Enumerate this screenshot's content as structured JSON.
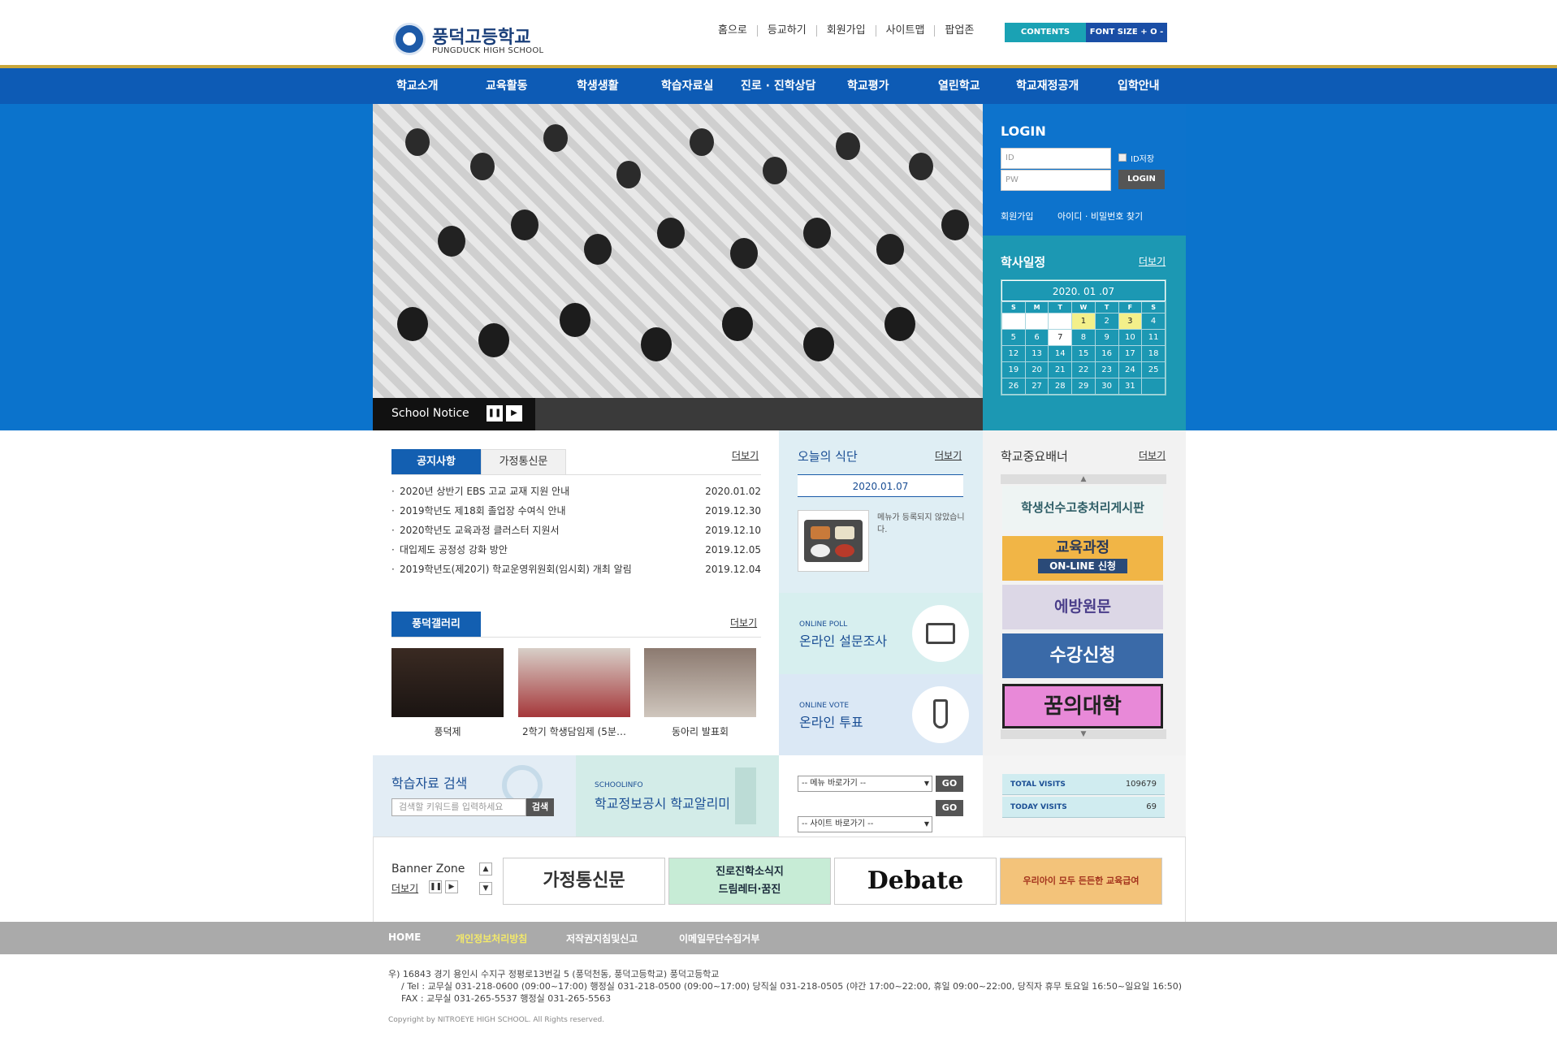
{
  "header": {
    "school_name": "풍덕고등학교",
    "school_name_en": "PUNGDUCK HIGH SCHOOL",
    "top_links": [
      "홈으로",
      "등교하기",
      "회원가입",
      "사이트맵",
      "팝업존"
    ],
    "contents_btn": "CONTENTS",
    "fontsize_btn": "FONT SIZE + O -"
  },
  "gnb": [
    "학교소개",
    "교육활동",
    "학생생활",
    "학습자료실",
    "진로 · 진학상담",
    "학교평가",
    "열린학교",
    "학교재정공개",
    "입학안내"
  ],
  "hero": {
    "notice_label": "School Notice",
    "pause_icon": "pause-icon",
    "next_icon": "next-icon"
  },
  "login": {
    "title": "LOGIN",
    "id_placeholder": "ID",
    "pw_placeholder": "PW",
    "id_save": "ID저장",
    "login_btn": "LOGIN",
    "join": "회원가입",
    "find": "아이디 · 비밀번호 찾기"
  },
  "calendar": {
    "title": "학사일정",
    "more": "더보기",
    "month": "2020. 01 .07",
    "dow": [
      "S",
      "M",
      "T",
      "W",
      "T",
      "F",
      "S"
    ],
    "weeks": [
      [
        "",
        "",
        "",
        "1",
        "2",
        "3",
        "4"
      ],
      [
        "5",
        "6",
        "7",
        "8",
        "9",
        "10",
        "11"
      ],
      [
        "12",
        "13",
        "14",
        "15",
        "16",
        "17",
        "18"
      ],
      [
        "19",
        "20",
        "21",
        "22",
        "23",
        "24",
        "25"
      ],
      [
        "26",
        "27",
        "28",
        "29",
        "30",
        "31",
        ""
      ]
    ],
    "highlight_days": [
      "1",
      "3"
    ],
    "today": "7",
    "highlight_color": "#f3f08a"
  },
  "notice": {
    "tab_active": "공지사항",
    "tab_inactive": "가정통신문",
    "more": "더보기",
    "items": [
      {
        "title": "2020년 상반기 EBS 고교 교재 지원 안내",
        "date": "2020.01.02"
      },
      {
        "title": "2019학년도 제18회 졸업장 수여식 안내",
        "date": "2019.12.30"
      },
      {
        "title": "2020학년도 교육과정 클러스터 지원서",
        "date": "2019.12.10"
      },
      {
        "title": "대입제도 공정성 강화 방안",
        "date": "2019.12.05"
      },
      {
        "title": "2019학년도(제20기) 학교운영위원회(임시회) 개최 알림",
        "date": "2019.12.04"
      }
    ]
  },
  "meal": {
    "title": "오늘의 식단",
    "more": "더보기",
    "date": "2020.01.07",
    "text": "메뉴가 등록되지 않았습니다."
  },
  "school_banners": {
    "title": "학교중요배너",
    "more": "더보기",
    "items": [
      "학생선수고충처리게시판",
      "교육과정",
      "ON-LINE 신청",
      "에방원문",
      "수강신청",
      "꿈의대학"
    ],
    "up_icon": "chevron-up-icon",
    "down_icon": "chevron-down-icon"
  },
  "gallery": {
    "title": "풍덕갤러리",
    "more": "더보기",
    "items": [
      "풍덕제",
      "2학기 학생담임제 (5분…",
      "동아리 발표회"
    ]
  },
  "poll": {
    "en": "ONLINE POLL",
    "ko": "온라인 설문조사"
  },
  "vote": {
    "en": "ONLINE VOTE",
    "ko": "온라인 투표"
  },
  "search": {
    "title": "학습자료 검색",
    "placeholder": "검색할 키워드를 입력하세요",
    "btn": "검색"
  },
  "schoolinfo": {
    "en": "SCHOOLINFO",
    "ko": "학교정보공시 학교알리미"
  },
  "goto": {
    "menu_select": "-- 메뉴 바로가기 --",
    "site_select": "-- 사이트 바로가기 --",
    "go": "GO"
  },
  "visits": {
    "total_label": "TOTAL VISITS",
    "total": "109679",
    "today_label": "TODAY VISITS",
    "today": "69"
  },
  "banner_zone": {
    "title": "Banner Zone",
    "more": "더보기",
    "items": [
      "가정통신문",
      "진로진학소식지",
      "드림레터·꿈진",
      "Debate",
      "우리아이 모두 든든한 교육급여"
    ]
  },
  "footer": {
    "links": [
      "HOME",
      "개인정보처리방침",
      "저작권지침및신고",
      "이메일무단수집거부"
    ],
    "highlight_color": "#f3e96a",
    "address": "우) 16843 경기 용인시 수지구 정평로13번길 5 (풍덕천동, 풍덕고등학교) 풍덕고등학교",
    "tel": "/ Tel : 교무실 031-218-0600 (09:00~17:00) 행정실 031-218-0500 (09:00~17:00) 당직실 031-218-0505 (야간 17:00~22:00, 휴일 09:00~22:00, 당직자 휴무 토요일 16:50~일요일 16:50)",
    "fax": "FAX : 교무실 031-265-5537 행정실 031-265-5563",
    "copyright": "Copyright by NITROEYE HIGH SCHOOL. All Rights reserved."
  }
}
